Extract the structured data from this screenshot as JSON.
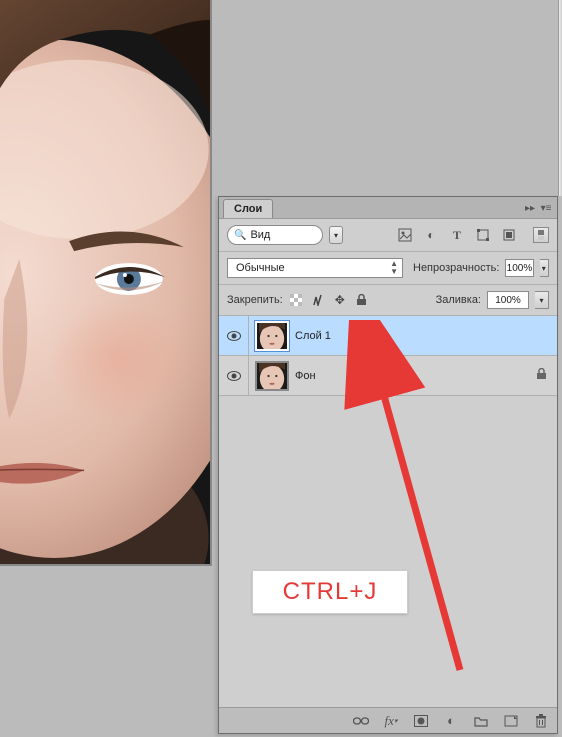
{
  "panel": {
    "tab_label": "Слои",
    "search_label": "Вид",
    "blend_mode": "Обычные",
    "opacity_label": "Непрозрачность:",
    "opacity_value": "100%",
    "lock_label": "Закрепить:",
    "fill_label": "Заливка:",
    "fill_value": "100%"
  },
  "layers": [
    {
      "name": "Слой 1",
      "selected": true,
      "locked": false
    },
    {
      "name": "Фон",
      "selected": false,
      "locked": true
    }
  ],
  "annotation": {
    "text": "CTRL+J"
  }
}
